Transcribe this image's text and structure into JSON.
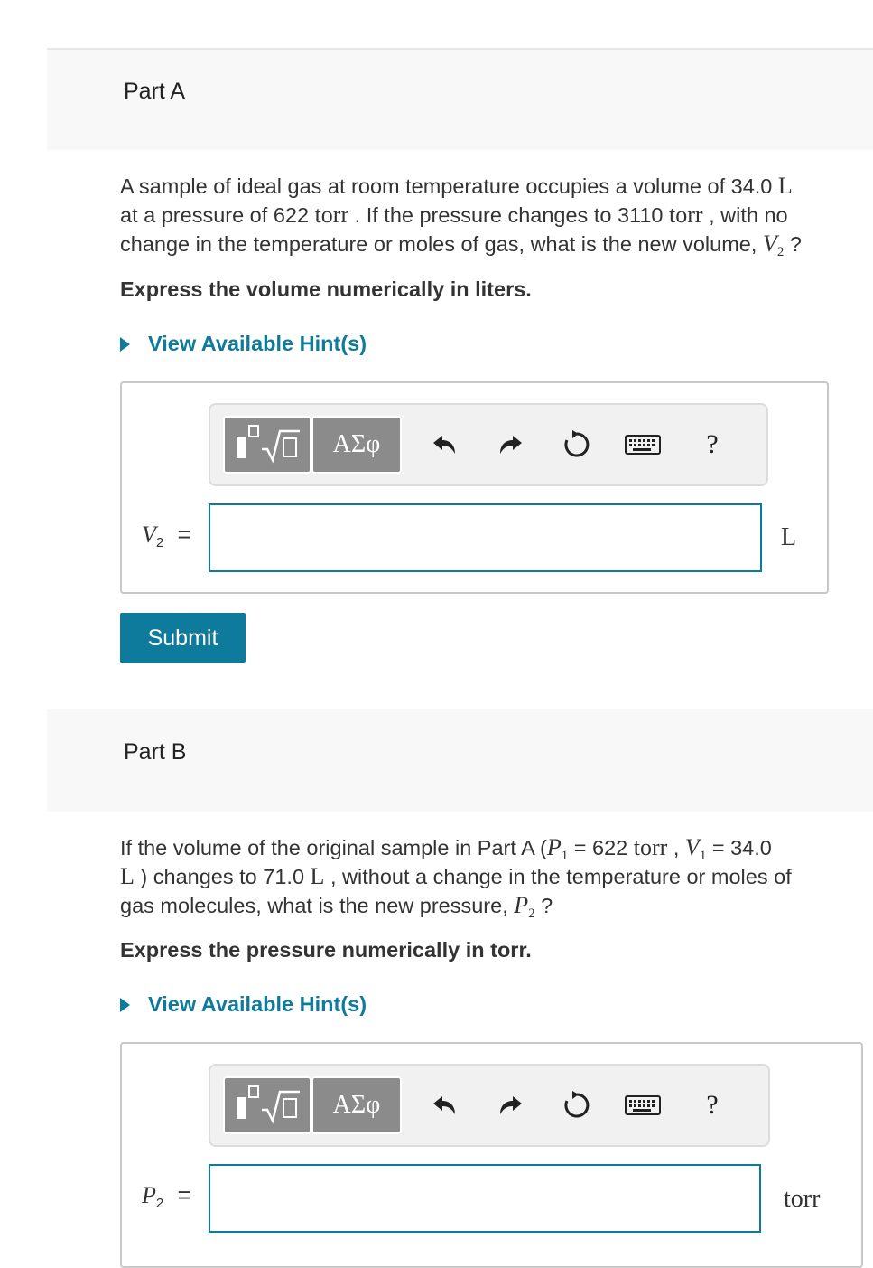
{
  "part_a": {
    "title": "Part A",
    "line1_text": "A sample of ideal gas at room temperature occupies a volume of 34.0 ",
    "line1_unit": "L",
    "line2_a": "at a pressure of 622 ",
    "line2_unit1": "torr",
    "line2_b": " . If the pressure changes to 3110 ",
    "line2_unit2": "torr",
    "line2_c": " , with no",
    "line3_text": "change in the temperature or moles of gas, what is the new volume, ",
    "line3_var": "V",
    "line3_sub": "2",
    "line3_end": " ?",
    "express": "Express the volume numerically in liters.",
    "hint": "View Available Hint(s)",
    "var": "V",
    "var_sub": "2",
    "eq": "=",
    "unit": "L",
    "submit": "Submit"
  },
  "part_b": {
    "title": "Part B",
    "line1_a": "If the volume of the original sample in Part A (",
    "p1": "P",
    "p1_sub": "1",
    "line1_b": " = 622 ",
    "torr": "torr",
    "line1_c": " , ",
    "v1": "V",
    "v1_sub": "1",
    "line1_d": " = 34.0",
    "line2_unit1": "L",
    "line2_a": " ) changes to 71.0 ",
    "line2_unit2": "L",
    "line2_b": " , without a change in the temperature or moles of",
    "line3_a": "gas molecules, what is the new pressure, ",
    "line3_var": "P",
    "line3_sub": "2",
    "line3_end": " ?",
    "express": "Express the pressure numerically in torr.",
    "hint": "View Available Hint(s)",
    "var": "P",
    "var_sub": "2",
    "eq": "=",
    "unit": "torr"
  },
  "toolbar": {
    "greek": "ΑΣφ",
    "help": "?",
    "icons": [
      "templates-icon",
      "greek-letters-icon",
      "undo-icon",
      "redo-icon",
      "reset-icon",
      "keyboard-icon",
      "help-icon"
    ]
  }
}
